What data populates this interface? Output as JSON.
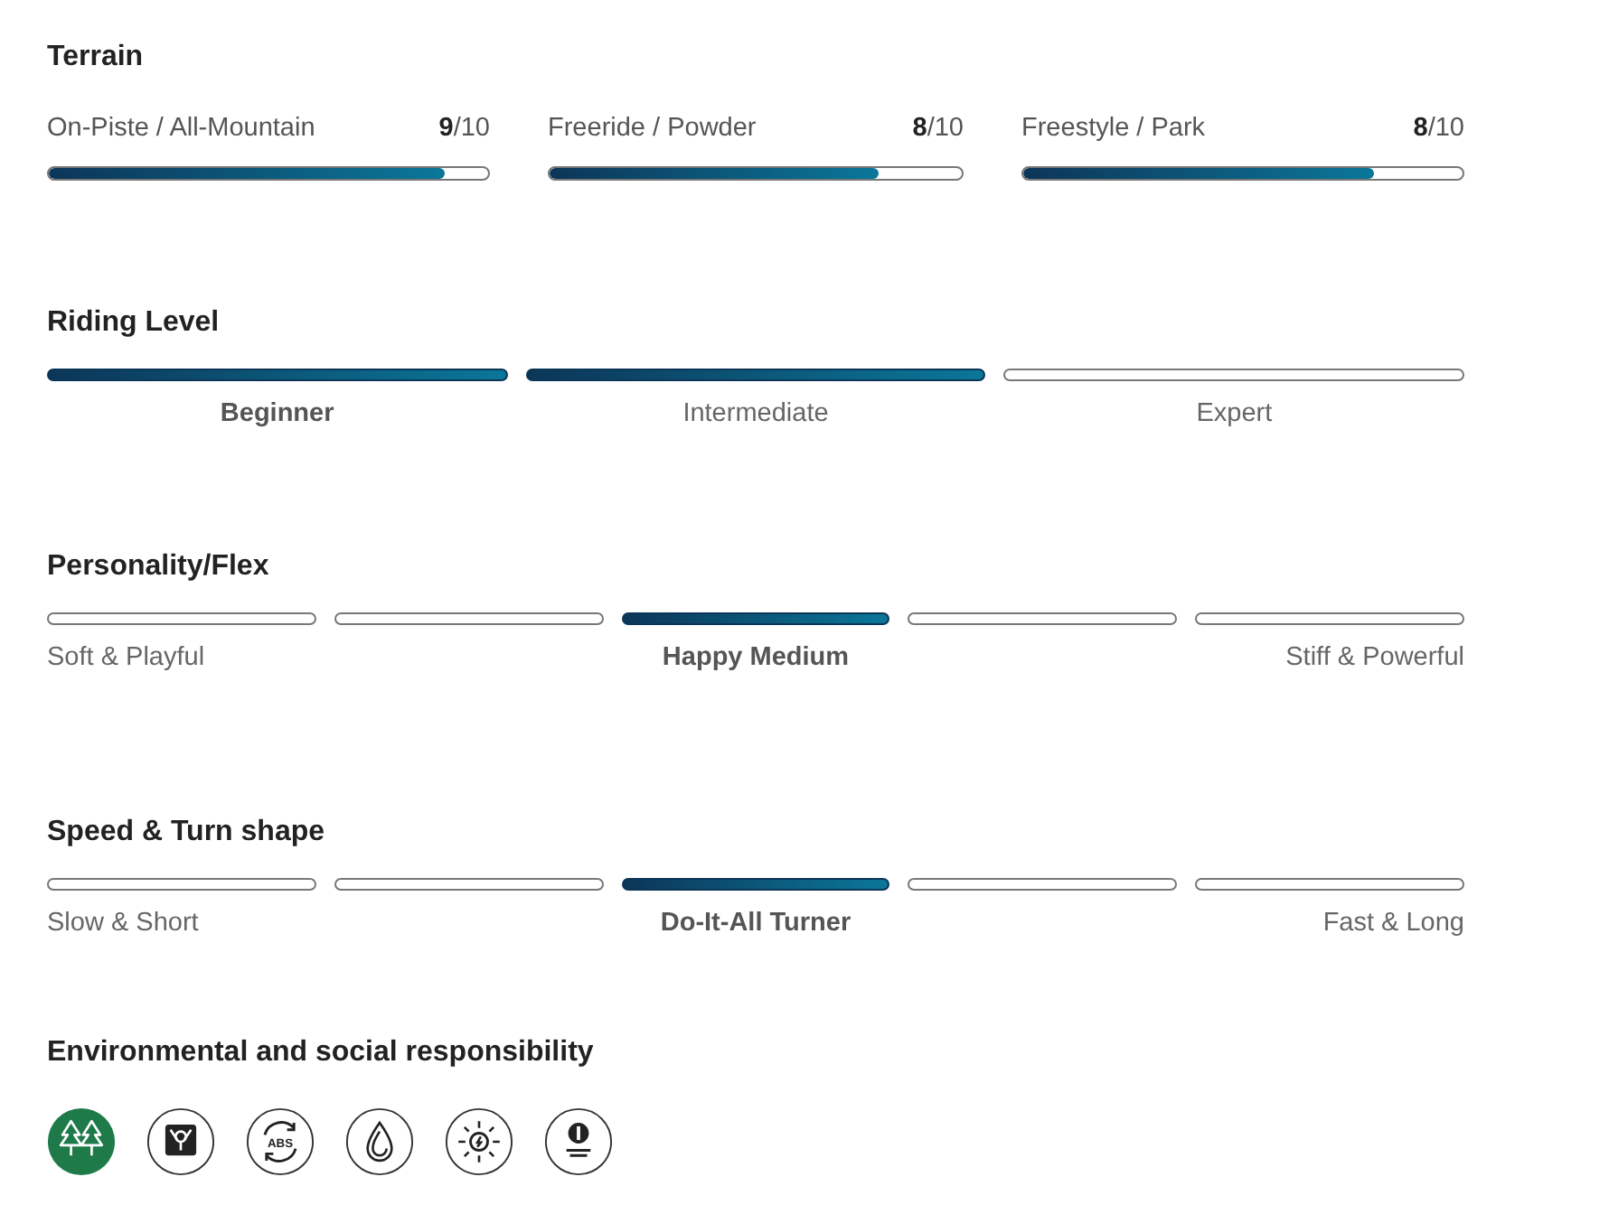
{
  "terrain": {
    "title": "Terrain",
    "items": [
      {
        "label": "On-Piste / All-Mountain",
        "score": "**9**/10",
        "level": 0.9
      },
      {
        "label": "Freeride / Powder",
        "score": "**8**/10",
        "level": 0.8
      },
      {
        "label": "Freestyle / Park",
        "score": "**8**/10",
        "level": 0.8
      }
    ]
  },
  "scales": [
    {
      "title": "Riding Level",
      "kind": "three-step",
      "segments": [
        {
          "filled": true,
          "label": "Beginner",
          "selected": true
        },
        {
          "filled": true,
          "label": "Intermediate",
          "selected": false
        },
        {
          "filled": false,
          "label": "Expert",
          "selected": false
        }
      ]
    },
    {
      "title": "Personality/Flex",
      "kind": "five-step",
      "segments": [
        {
          "filled": false,
          "label": "Soft & Playful",
          "selected": false
        },
        {
          "filled": false
        },
        {
          "filled": true,
          "label": "Happy Medium",
          "selected": true
        },
        {
          "filled": false
        },
        {
          "filled": false,
          "label": "Stiff & Powerful",
          "selected": false
        }
      ]
    },
    {
      "title": "Speed & Turn shape",
      "kind": "five-step",
      "segments": [
        {
          "filled": false,
          "label": "Slow & Short",
          "selected": false
        },
        {
          "filled": false
        },
        {
          "filled": true,
          "label": "Do-It-All Turner",
          "selected": true
        },
        {
          "filled": false
        },
        {
          "filled": false,
          "label": "Fast & Long",
          "selected": false
        }
      ]
    }
  ],
  "responsibility": {
    "title": "Environmental and social responsibility",
    "badges": [
      {
        "kind": "trees",
        "selected": true
      },
      {
        "kind": "figure",
        "selected": false
      },
      {
        "kind": "abs",
        "selected": false,
        "text": "ABS"
      },
      {
        "kind": "drop",
        "selected": false
      },
      {
        "kind": "sun",
        "selected": false
      },
      {
        "kind": "planet",
        "selected": false
      }
    ]
  }
}
